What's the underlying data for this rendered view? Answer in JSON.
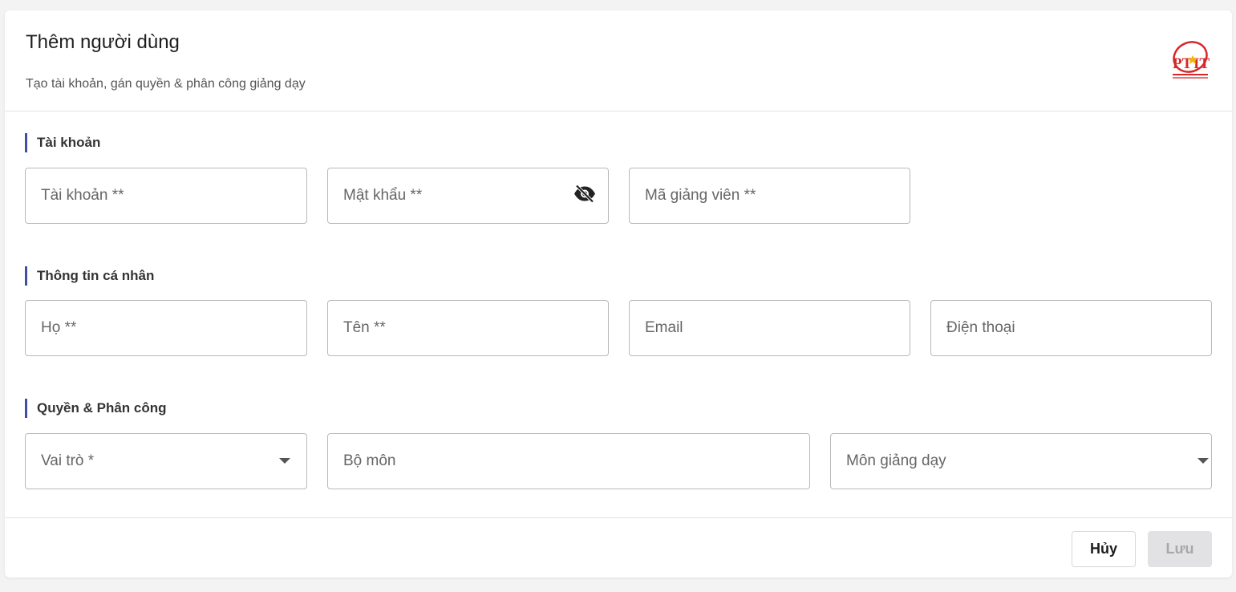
{
  "header": {
    "title": "Thêm người dùng",
    "subtitle": "Tạo tài khoản, gán quyền & phân công giảng dạy",
    "logo_text": "PTIT",
    "logo_color": "#d62828"
  },
  "sections": {
    "account": {
      "title": "Tài khoản",
      "username_placeholder": "Tài khoản **",
      "password_placeholder": "Mật khẩu **",
      "teacher_code_placeholder": "Mã giảng viên **"
    },
    "personal": {
      "title": "Thông tin cá nhân",
      "last_name_placeholder": "Họ **",
      "first_name_placeholder": "Tên **",
      "email_placeholder": "Email",
      "phone_placeholder": "Điện thoại"
    },
    "roles": {
      "title": "Quyền & Phân công",
      "role_placeholder": "Vai trò *",
      "department_placeholder": "Bộ môn",
      "subjects_placeholder": "Môn giảng dạy"
    }
  },
  "footer": {
    "cancel_label": "Hủy",
    "save_label": "Lưu"
  },
  "colors": {
    "accent": "#3f4fa3",
    "save_disabled_bg": "#e2e2e4"
  },
  "icons": {
    "password_toggle": "eye-off-icon",
    "dropdown": "caret-down-icon"
  }
}
